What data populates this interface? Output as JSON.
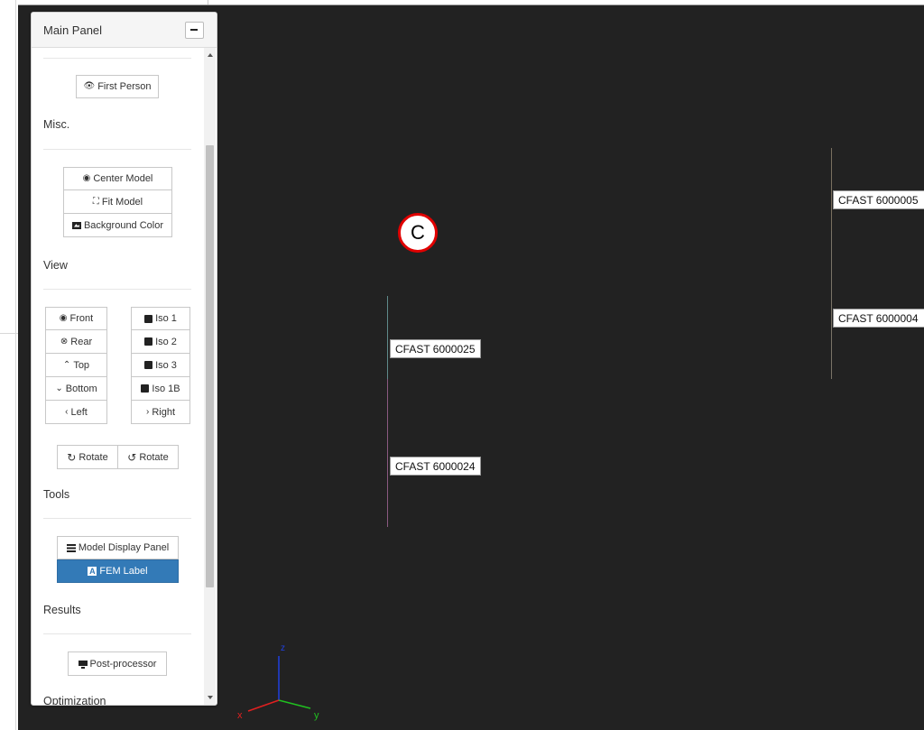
{
  "panel": {
    "title": "Main Panel",
    "sections": {
      "misc": "Misc.",
      "view": "View",
      "tools": "Tools",
      "results": "Results",
      "optimization": "Optimization"
    },
    "buttons": {
      "first_person": "First Person",
      "center_model": "Center Model",
      "fit_model": "Fit Model",
      "background_color": "Background Color",
      "front": "Front",
      "rear": "Rear",
      "top": "Top",
      "bottom": "Bottom",
      "left": "Left",
      "iso1": "Iso 1",
      "iso2": "Iso 2",
      "iso3": "Iso 3",
      "iso1b": "Iso 1B",
      "right": "Right",
      "rotate_cw": "Rotate",
      "rotate_ccw": "Rotate",
      "model_display_panel": "Model Display Panel",
      "fem_label": "FEM Label",
      "post_processor": "Post-processor"
    }
  },
  "viewport": {
    "marker_letter": "C",
    "labels": {
      "l1": "CFAST 6000025",
      "l2": "CFAST 6000024",
      "l3": "CFAST 6000005",
      "l4": "CFAST 6000004"
    },
    "axes": {
      "x": "x",
      "y": "y",
      "z": "z"
    },
    "colors": {
      "background": "#222222",
      "axis_x": "#e02020",
      "axis_y": "#20c020",
      "axis_z": "#2040e0"
    }
  }
}
